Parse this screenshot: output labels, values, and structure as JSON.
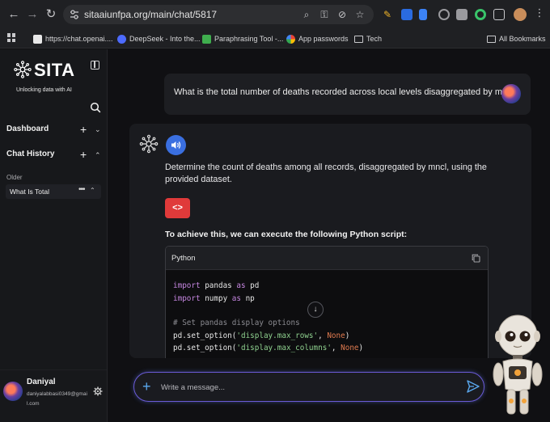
{
  "browser": {
    "url": "sitaaiunfpa.org/main/chat/5817",
    "bookmarks": [
      {
        "label": "https://chat.openai....",
        "color": "#e8e8e8"
      },
      {
        "label": "DeepSeek - Into the...",
        "color": "#4d6bfe"
      },
      {
        "label": "Paraphrasing Tool -...",
        "color": "#3fae4e"
      },
      {
        "label": "App passwords",
        "color": "#4285f4"
      },
      {
        "label": "Tech",
        "color": "#c9c9cc"
      }
    ],
    "all_bookmarks_label": "All Bookmarks"
  },
  "sidebar": {
    "logo_text": "SITA",
    "tagline": "Unlocking data with AI",
    "dashboard_label": "Dashboard",
    "chat_history_label": "Chat History",
    "older_label": "Older",
    "history_items": [
      {
        "label": "What Is Total"
      }
    ],
    "user": {
      "name": "Daniyal",
      "email": "daniyalabbasi0349@gmail.com"
    }
  },
  "chat": {
    "user_message": "What is the total number of deaths recorded across local levels disaggregated by mncl?",
    "bot_text": "Determine the count of deaths among all records, disaggregated by mncl, using the provided dataset.",
    "code_toggle_label": "<>",
    "script_intro": "To achieve this, we can execute the following Python script:",
    "code_language": "Python",
    "code_lines": [
      "import pandas as pd",
      "import numpy as np",
      "",
      "# Set pandas display options",
      "pd.set_option('display.max_rows', None)",
      "pd.set_option('display.max_columns', None)"
    ]
  },
  "composer": {
    "placeholder": "Write a message..."
  },
  "colors": {
    "accent_blue": "#3a6fe0",
    "code_red": "#e03a3a",
    "composer_border": "#6b5ad6"
  }
}
